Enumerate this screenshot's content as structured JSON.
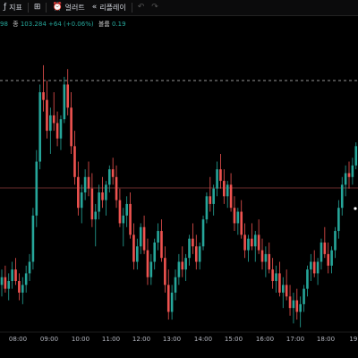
{
  "toolbar": {
    "indicators_label": "지표",
    "templates_icon": "grid-icon",
    "alert_label": "얼러트",
    "replay_label": "리플레이",
    "undo_icon": "undo-icon",
    "redo_icon": "redo-icon"
  },
  "legend": {
    "open_tail": "98",
    "close_label": "종",
    "close_value": "103.284",
    "change_value": "+64 (+0.06%)",
    "volume_label": "볼륨",
    "volume_value": "0.19"
  },
  "colors": {
    "up": "#26a69a",
    "down": "#ef5350",
    "background": "#000000",
    "hline_price": "#8b3a3a",
    "hline_dashed": "#c8c8c8"
  },
  "chart_data": {
    "type": "candlestick",
    "x_ticks": [
      "08:00",
      "09:00",
      "10:00",
      "11:00",
      "12:00",
      "13:00",
      "14:00",
      "15:00",
      "16:00",
      "17:00",
      "18:00",
      "19:"
    ],
    "grid": false,
    "price_level_line": "solid",
    "high_level_line": "dashed",
    "series": [
      {
        "o": 40,
        "h": 44,
        "l": 37,
        "c": 42
      },
      {
        "o": 42,
        "h": 45,
        "l": 38,
        "c": 39
      },
      {
        "o": 39,
        "h": 43,
        "l": 36,
        "c": 41
      },
      {
        "o": 41,
        "h": 46,
        "l": 39,
        "c": 44
      },
      {
        "o": 44,
        "h": 47,
        "l": 40,
        "c": 41
      },
      {
        "o": 41,
        "h": 43,
        "l": 36,
        "c": 38
      },
      {
        "o": 38,
        "h": 42,
        "l": 35,
        "c": 40
      },
      {
        "o": 40,
        "h": 45,
        "l": 38,
        "c": 43
      },
      {
        "o": 43,
        "h": 48,
        "l": 41,
        "c": 46
      },
      {
        "o": 46,
        "h": 60,
        "l": 44,
        "c": 58
      },
      {
        "o": 58,
        "h": 75,
        "l": 55,
        "c": 72
      },
      {
        "o": 72,
        "h": 92,
        "l": 70,
        "c": 90
      },
      {
        "o": 90,
        "h": 97,
        "l": 85,
        "c": 88
      },
      {
        "o": 88,
        "h": 93,
        "l": 78,
        "c": 80
      },
      {
        "o": 80,
        "h": 86,
        "l": 74,
        "c": 84
      },
      {
        "o": 84,
        "h": 90,
        "l": 80,
        "c": 82
      },
      {
        "o": 82,
        "h": 85,
        "l": 76,
        "c": 78
      },
      {
        "o": 78,
        "h": 84,
        "l": 75,
        "c": 83
      },
      {
        "o": 83,
        "h": 94,
        "l": 82,
        "c": 92
      },
      {
        "o": 92,
        "h": 96,
        "l": 84,
        "c": 86
      },
      {
        "o": 86,
        "h": 90,
        "l": 74,
        "c": 76
      },
      {
        "o": 76,
        "h": 80,
        "l": 66,
        "c": 68
      },
      {
        "o": 68,
        "h": 72,
        "l": 58,
        "c": 60
      },
      {
        "o": 60,
        "h": 66,
        "l": 56,
        "c": 64
      },
      {
        "o": 64,
        "h": 70,
        "l": 62,
        "c": 68
      },
      {
        "o": 68,
        "h": 72,
        "l": 63,
        "c": 65
      },
      {
        "o": 65,
        "h": 69,
        "l": 55,
        "c": 57
      },
      {
        "o": 57,
        "h": 61,
        "l": 50,
        "c": 59
      },
      {
        "o": 59,
        "h": 66,
        "l": 57,
        "c": 64
      },
      {
        "o": 64,
        "h": 68,
        "l": 60,
        "c": 62
      },
      {
        "o": 62,
        "h": 67,
        "l": 58,
        "c": 66
      },
      {
        "o": 66,
        "h": 71,
        "l": 64,
        "c": 70
      },
      {
        "o": 70,
        "h": 73,
        "l": 66,
        "c": 68
      },
      {
        "o": 68,
        "h": 71,
        "l": 60,
        "c": 62
      },
      {
        "o": 62,
        "h": 65,
        "l": 55,
        "c": 56
      },
      {
        "o": 56,
        "h": 60,
        "l": 50,
        "c": 58
      },
      {
        "o": 58,
        "h": 63,
        "l": 55,
        "c": 61
      },
      {
        "o": 61,
        "h": 64,
        "l": 52,
        "c": 53
      },
      {
        "o": 53,
        "h": 56,
        "l": 44,
        "c": 46
      },
      {
        "o": 46,
        "h": 52,
        "l": 44,
        "c": 50
      },
      {
        "o": 50,
        "h": 56,
        "l": 48,
        "c": 55
      },
      {
        "o": 55,
        "h": 58,
        "l": 48,
        "c": 49
      },
      {
        "o": 49,
        "h": 52,
        "l": 40,
        "c": 42
      },
      {
        "o": 42,
        "h": 48,
        "l": 40,
        "c": 46
      },
      {
        "o": 46,
        "h": 52,
        "l": 44,
        "c": 51
      },
      {
        "o": 51,
        "h": 56,
        "l": 49,
        "c": 54
      },
      {
        "o": 54,
        "h": 57,
        "l": 46,
        "c": 47
      },
      {
        "o": 47,
        "h": 50,
        "l": 38,
        "c": 40
      },
      {
        "o": 40,
        "h": 44,
        "l": 31,
        "c": 33
      },
      {
        "o": 33,
        "h": 40,
        "l": 31,
        "c": 38
      },
      {
        "o": 38,
        "h": 44,
        "l": 36,
        "c": 42
      },
      {
        "o": 42,
        "h": 48,
        "l": 40,
        "c": 46
      },
      {
        "o": 46,
        "h": 50,
        "l": 42,
        "c": 44
      },
      {
        "o": 44,
        "h": 48,
        "l": 41,
        "c": 47
      },
      {
        "o": 47,
        "h": 53,
        "l": 45,
        "c": 52
      },
      {
        "o": 52,
        "h": 56,
        "l": 48,
        "c": 50
      },
      {
        "o": 50,
        "h": 53,
        "l": 44,
        "c": 46
      },
      {
        "o": 46,
        "h": 51,
        "l": 44,
        "c": 50
      },
      {
        "o": 50,
        "h": 58,
        "l": 49,
        "c": 57
      },
      {
        "o": 57,
        "h": 64,
        "l": 56,
        "c": 63
      },
      {
        "o": 63,
        "h": 68,
        "l": 59,
        "c": 61
      },
      {
        "o": 61,
        "h": 66,
        "l": 58,
        "c": 65
      },
      {
        "o": 65,
        "h": 72,
        "l": 63,
        "c": 70
      },
      {
        "o": 70,
        "h": 74,
        "l": 65,
        "c": 67
      },
      {
        "o": 67,
        "h": 70,
        "l": 61,
        "c": 63
      },
      {
        "o": 63,
        "h": 67,
        "l": 60,
        "c": 66
      },
      {
        "o": 66,
        "h": 69,
        "l": 59,
        "c": 60
      },
      {
        "o": 60,
        "h": 63,
        "l": 54,
        "c": 56
      },
      {
        "o": 56,
        "h": 60,
        "l": 53,
        "c": 59
      },
      {
        "o": 59,
        "h": 62,
        "l": 52,
        "c": 53
      },
      {
        "o": 53,
        "h": 56,
        "l": 47,
        "c": 49
      },
      {
        "o": 49,
        "h": 53,
        "l": 46,
        "c": 52
      },
      {
        "o": 52,
        "h": 56,
        "l": 49,
        "c": 50
      },
      {
        "o": 50,
        "h": 54,
        "l": 46,
        "c": 53
      },
      {
        "o": 53,
        "h": 57,
        "l": 48,
        "c": 49
      },
      {
        "o": 49,
        "h": 52,
        "l": 44,
        "c": 46
      },
      {
        "o": 46,
        "h": 50,
        "l": 42,
        "c": 48
      },
      {
        "o": 48,
        "h": 51,
        "l": 43,
        "c": 44
      },
      {
        "o": 44,
        "h": 47,
        "l": 39,
        "c": 41
      },
      {
        "o": 41,
        "h": 45,
        "l": 38,
        "c": 43
      },
      {
        "o": 43,
        "h": 46,
        "l": 37,
        "c": 38
      },
      {
        "o": 38,
        "h": 42,
        "l": 34,
        "c": 40
      },
      {
        "o": 40,
        "h": 44,
        "l": 36,
        "c": 37
      },
      {
        "o": 37,
        "h": 40,
        "l": 32,
        "c": 34
      },
      {
        "o": 34,
        "h": 38,
        "l": 30,
        "c": 36
      },
      {
        "o": 36,
        "h": 39,
        "l": 31,
        "c": 33
      },
      {
        "o": 33,
        "h": 37,
        "l": 29,
        "c": 35
      },
      {
        "o": 35,
        "h": 40,
        "l": 33,
        "c": 39
      },
      {
        "o": 39,
        "h": 45,
        "l": 37,
        "c": 44
      },
      {
        "o": 44,
        "h": 48,
        "l": 41,
        "c": 46
      },
      {
        "o": 46,
        "h": 49,
        "l": 42,
        "c": 43
      },
      {
        "o": 43,
        "h": 47,
        "l": 40,
        "c": 46
      },
      {
        "o": 46,
        "h": 52,
        "l": 44,
        "c": 51
      },
      {
        "o": 51,
        "h": 55,
        "l": 47,
        "c": 48
      },
      {
        "o": 48,
        "h": 51,
        "l": 43,
        "c": 45
      },
      {
        "o": 45,
        "h": 50,
        "l": 43,
        "c": 49
      },
      {
        "o": 49,
        "h": 55,
        "l": 47,
        "c": 54
      },
      {
        "o": 54,
        "h": 62,
        "l": 52,
        "c": 60
      },
      {
        "o": 60,
        "h": 68,
        "l": 58,
        "c": 66
      },
      {
        "o": 66,
        "h": 71,
        "l": 63,
        "c": 69
      },
      {
        "o": 69,
        "h": 72,
        "l": 65,
        "c": 68
      },
      {
        "o": 68,
        "h": 73,
        "l": 66,
        "c": 71
      },
      {
        "o": 71,
        "h": 77,
        "l": 70,
        "c": 76
      },
      {
        "o": 76,
        "h": 79,
        "l": 72,
        "c": 74
      },
      {
        "o": 74,
        "h": 78,
        "l": 71,
        "c": 73
      }
    ]
  }
}
